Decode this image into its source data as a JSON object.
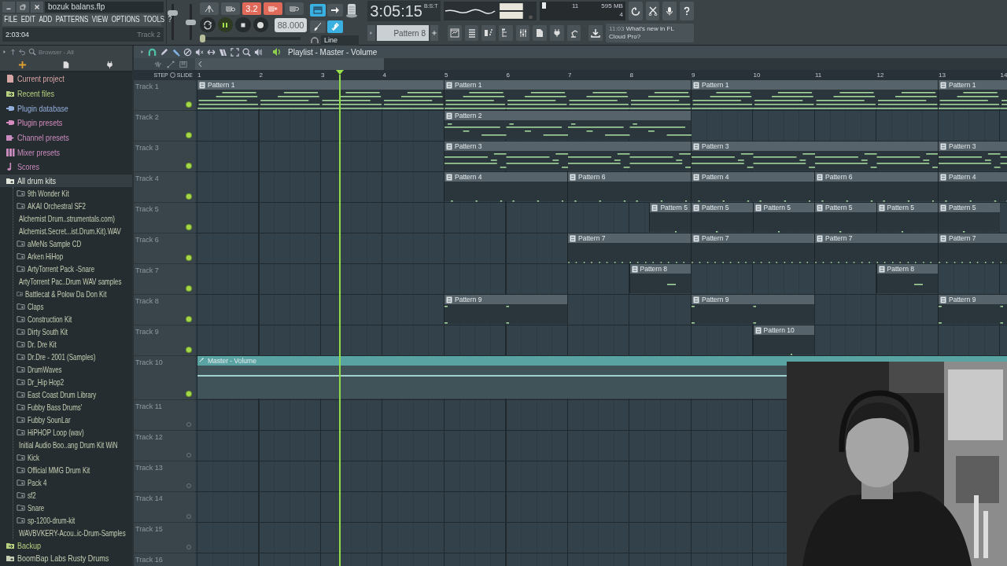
{
  "toolbar": {
    "title": "bozuk balans.flp",
    "menu": [
      "FILE",
      "EDIT",
      "ADD",
      "PATTERNS",
      "VIEW",
      "OPTIONS",
      "TOOLS",
      "?"
    ],
    "song_position": "2:03:04",
    "hint": "Track 2",
    "master_volume": {
      "level": 0.8
    },
    "master_pitch": {
      "level": 0.5
    },
    "pattern_song_label": "3.2",
    "playing": true,
    "tempo": "88.000",
    "swing": {
      "level": 0
    },
    "snap": "Line",
    "time": "3:05:15",
    "time_unit": "B:S:T",
    "cpu": "11",
    "memory": "595 MB",
    "polyphony": "4",
    "pattern": "Pattern 8",
    "news_time": "11:03",
    "news": "What's new in FL Cloud Pro?"
  },
  "browser": {
    "title": "Browser - All",
    "items": [
      {
        "label": "Current project",
        "kind": "project",
        "color": "#d9a6a6",
        "expanded": false
      },
      {
        "label": "Recent files",
        "kind": "history",
        "color": "#b5d07f",
        "expanded": false
      },
      {
        "label": "Plugin database",
        "kind": "plugin",
        "color": "#92aedb",
        "expanded": false
      },
      {
        "label": "Plugin presets",
        "kind": "plugin",
        "color": "#d58bbd",
        "expanded": false
      },
      {
        "label": "Channel presets",
        "kind": "channel",
        "color": "#c98bbd",
        "expanded": false
      },
      {
        "label": "Mixer presets",
        "kind": "mixer",
        "color": "#c98bbd",
        "expanded": false
      },
      {
        "label": "Scores",
        "kind": "score",
        "color": "#c98bbd",
        "expanded": false
      },
      {
        "label": "All drum kits",
        "kind": "folder",
        "color": "#e3e8dc",
        "expanded": true,
        "children": [
          {
            "label": "9th Wonder Kit"
          },
          {
            "label": "AKAI Orchestral SF2"
          },
          {
            "label": "Alchemist Drum..strumentals.com)"
          },
          {
            "label": "Alchemist.Secret...ist.Drum.Kit).WAV"
          },
          {
            "label": "aMeNs Sample CD"
          },
          {
            "label": "Arken HiHop"
          },
          {
            "label": "ArtyTorrent Pack -Snare"
          },
          {
            "label": "ArtyTorrent Pac..Drum WAV samples"
          },
          {
            "label": "Battlecat & Polow Da Don Kit"
          },
          {
            "label": "Claps"
          },
          {
            "label": "Construction Kit"
          },
          {
            "label": "Dirty South Kit"
          },
          {
            "label": "Dr. Dre Kit"
          },
          {
            "label": "Dr.Dre - 2001 (Samples)"
          },
          {
            "label": "DrumWaves"
          },
          {
            "label": "Dr_Hip Hop2"
          },
          {
            "label": "East Coast Drum Library"
          },
          {
            "label": "Fubby   Bass Drums'"
          },
          {
            "label": "Fubby SounLar"
          },
          {
            "label": "HiPHOP Loop (wav)"
          },
          {
            "label": "Initial Audio Boo..ang Drum Kit WiN"
          },
          {
            "label": "Kick"
          },
          {
            "label": "Official MMG Drum Kit"
          },
          {
            "label": "Pack 4"
          },
          {
            "label": "sf2"
          },
          {
            "label": "Snare"
          },
          {
            "label": "sp-1200-drum-kit"
          },
          {
            "label": "WAVBVKERY-Acou..ic-Drum-Samples"
          }
        ]
      },
      {
        "label": "Backup",
        "kind": "history",
        "color": "#b5d07f",
        "expanded": false
      },
      {
        "label": "BoomBap Labs Rusty Drums",
        "kind": "folder",
        "color": "#c6ceb4",
        "expanded": false
      }
    ]
  },
  "playlist": {
    "title": "Playlist - Master - Volume",
    "step_label": "STEP",
    "slide_label": "SLIDE",
    "ruler": [
      "1",
      "2",
      "3",
      "4",
      "5",
      "6",
      "7",
      "8",
      "9",
      "10",
      "11",
      "12",
      "13",
      "14"
    ],
    "tracks": [
      {
        "name": "Track 1",
        "kind": "pattern",
        "lit": true,
        "clips": [
          {
            "label": "Pattern 1"
          },
          {
            "label": "Pattern 1"
          },
          {
            "label": "Pattern 1"
          },
          {
            "label": "Pattern 1"
          }
        ]
      },
      {
        "name": "Track 2",
        "kind": "pattern",
        "lit": true,
        "clips": [
          {
            "label": "Pattern 2"
          }
        ]
      },
      {
        "name": "Track 3",
        "kind": "pattern",
        "lit": true,
        "clips": [
          {
            "label": "Pattern 3"
          },
          {
            "label": "Pattern 3"
          },
          {
            "label": "Pattern 3"
          }
        ]
      },
      {
        "name": "Track 4",
        "kind": "pattern",
        "lit": true,
        "clips": [
          {
            "label": "Pattern 4"
          },
          {
            "label": "Pattern 6"
          },
          {
            "label": "Pattern 4"
          },
          {
            "label": "Pattern 6"
          },
          {
            "label": "Pattern 4"
          }
        ]
      },
      {
        "name": "Track 5",
        "kind": "pattern",
        "lit": true,
        "clips": [
          {
            "label": "Pattern 5"
          },
          {
            "label": "Pattern 5"
          },
          {
            "label": "Pattern 5"
          },
          {
            "label": "Pattern 5"
          },
          {
            "label": "Pattern 5"
          },
          {
            "label": "Pattern 5"
          }
        ]
      },
      {
        "name": "Track 6",
        "kind": "pattern",
        "lit": true,
        "clips": [
          {
            "label": "Pattern 7"
          },
          {
            "label": "Pattern 7"
          },
          {
            "label": "Pattern 7"
          },
          {
            "label": "Pattern 7"
          }
        ]
      },
      {
        "name": "Track 7",
        "kind": "pattern",
        "lit": true,
        "clips": [
          {
            "label": "Pattern 8"
          },
          {
            "label": "Pattern 8"
          }
        ]
      },
      {
        "name": "Track 8",
        "kind": "pattern",
        "lit": true,
        "clips": [
          {
            "label": "Pattern 9"
          },
          {
            "label": "Pattern 9"
          },
          {
            "label": "Pattern 9"
          }
        ]
      },
      {
        "name": "Track 9",
        "kind": "pattern",
        "lit": true,
        "clips": [
          {
            "label": "Pattern 10"
          }
        ]
      },
      {
        "name": "Track 10",
        "kind": "automation",
        "lit": true,
        "clips": [
          {
            "label": "Master - Volume"
          }
        ]
      },
      {
        "name": "Track 11",
        "kind": "pattern",
        "lit": false
      },
      {
        "name": "Track 12",
        "kind": "pattern",
        "lit": false
      },
      {
        "name": "Track 13",
        "kind": "pattern",
        "lit": false
      },
      {
        "name": "Track 14",
        "kind": "pattern",
        "lit": false
      },
      {
        "name": "Track 15",
        "kind": "pattern",
        "lit": false
      },
      {
        "name": "Track 16",
        "kind": "pattern"
      }
    ]
  }
}
